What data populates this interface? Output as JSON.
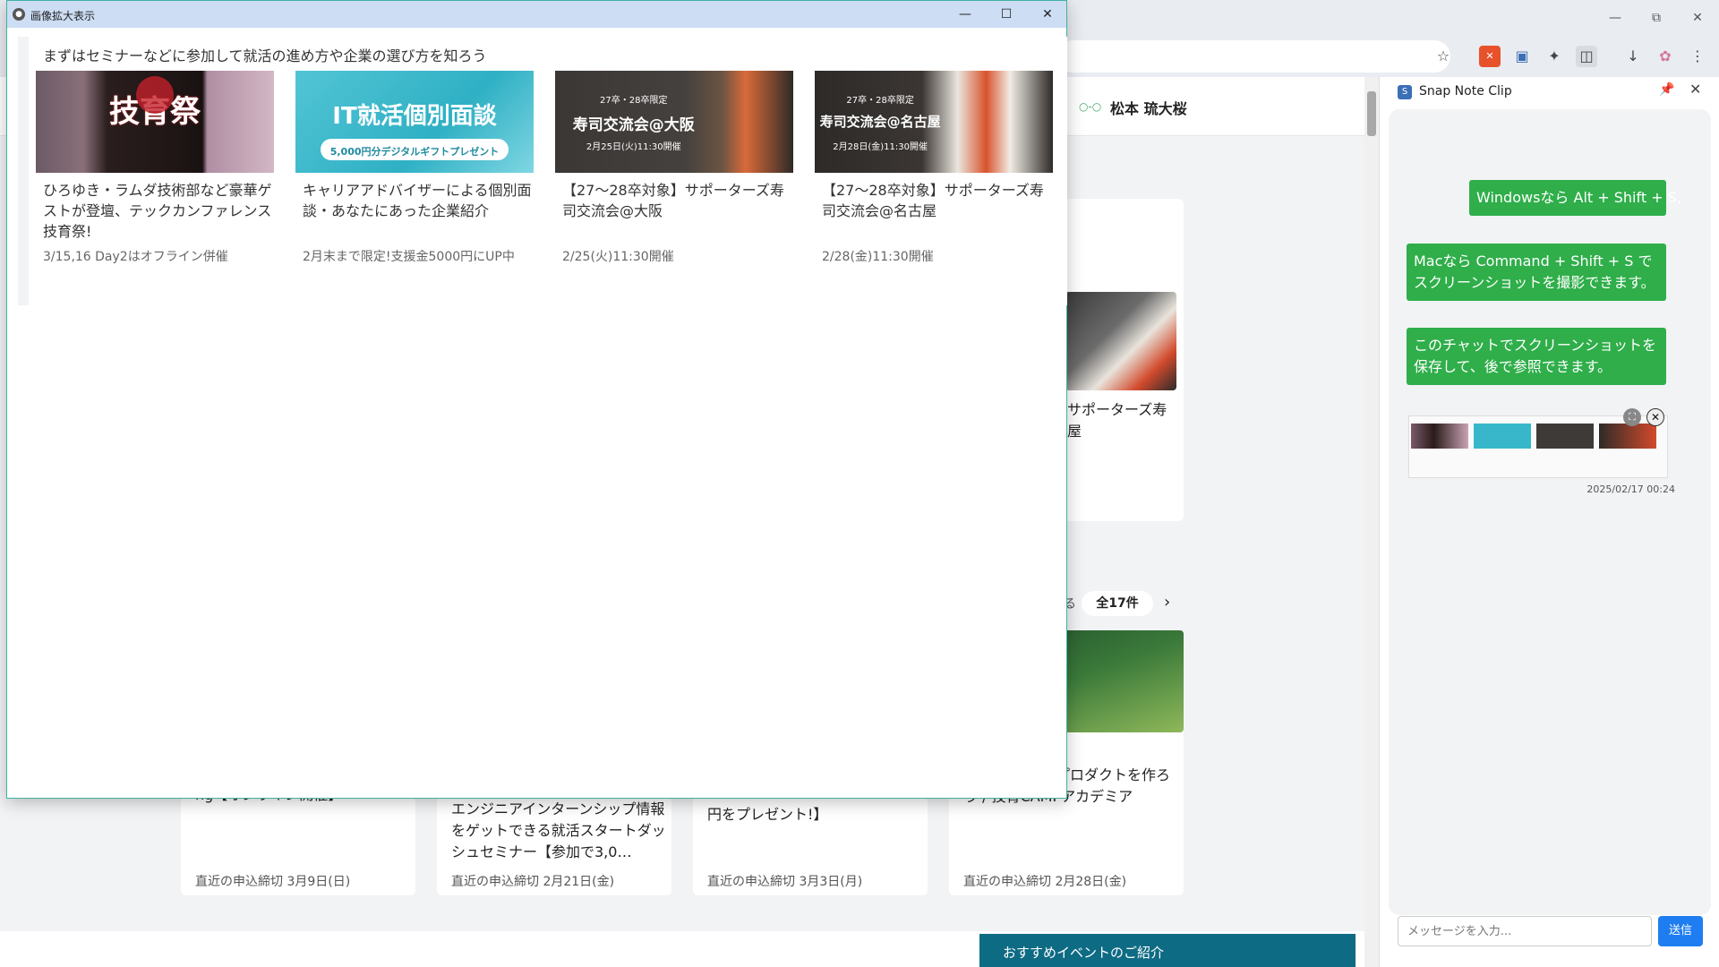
{
  "overlay": {
    "title": "画像拡大表示",
    "section_heading": "まずはセミナーなどに参加して就活の進め方や企業の選び方を知ろう",
    "cards": [
      {
        "image_alt": "技育祭",
        "image_text": "技育祭",
        "title": "ひろゆき・ラムダ技術部など豪華ゲストが登壇、テックカンファレンス技育祭!",
        "subtitle": "3/15,16 Day2はオフライン併催"
      },
      {
        "image_alt": "IT就活個別面談",
        "image_text": "IT就活個別面談",
        "image_sub": "5,000円分デジタルギフトプレゼント",
        "title": "キャリアアドバイザーによる個別面談・あなたにあった企業紹介",
        "subtitle": "2月末まで限定!支援金5000円にUP中"
      },
      {
        "image_alt": "寿司交流会@大阪",
        "image_text": "寿司交流会@大阪",
        "image_tag": "27卒・28卒限定",
        "image_date": "2月25日(火)11:30開催",
        "title": "【27〜28卒対象】サポーターズ寿司交流会@大阪",
        "subtitle": "2/25(火)11:30開催"
      },
      {
        "image_alt": "寿司交流会@名古屋",
        "image_text": "寿司交流会@名古屋",
        "image_tag": "27卒・28卒限定",
        "image_date": "2月28日(金)11:30開催",
        "title": "【27〜28卒対象】サポーターズ寿司交流会@名古屋",
        "subtitle": "2/28(金)11:30開催"
      }
    ]
  },
  "background_page": {
    "user_name": "松本 琉大桜",
    "partial_title_1": "サポーターズ寿",
    "partial_title_1b": "屋",
    "count_label": "全17件",
    "partial_card_title": "ogle Apps Scプロダクトを作ろう / 技育CAMPアカデミア",
    "lower_cards": [
      {
        "title": "ng【オンライン開催】",
        "deadline": "直近の申込締切  3月9日(日)"
      },
      {
        "title": "エンジニアインターンシップ情報をゲットできる就活スタートダッシュセミナー【参加で3,0…",
        "deadline": "直近の申込締切  2月21日(金)"
      },
      {
        "title": "円をプレゼント!】",
        "deadline": "直近の申込締切  3月3日(月)"
      },
      {
        "title": "",
        "deadline": "直近の申込締切  2月28日(金)"
      }
    ],
    "recommend_banner": "おすすめイベントのご紹介"
  },
  "side_panel": {
    "title": "Snap Note Clip",
    "messages": [
      "Windowsなら Alt + Shift + S,",
      "Macなら Command + Shift + S でスクリーンショットを撮影できます。",
      "このチャットでスクリーンショットを保存して、後で参照できます。"
    ],
    "screenshot_timestamp": "2025/02/17 00:24",
    "input_placeholder": "メッセージを入力...",
    "send_label": "送信"
  },
  "colors": {
    "bubble_green": "#2fae4a",
    "send_blue": "#1e7df0",
    "overlay_titlebar": "#ccddf4",
    "banner_teal": "#0e6b84"
  }
}
